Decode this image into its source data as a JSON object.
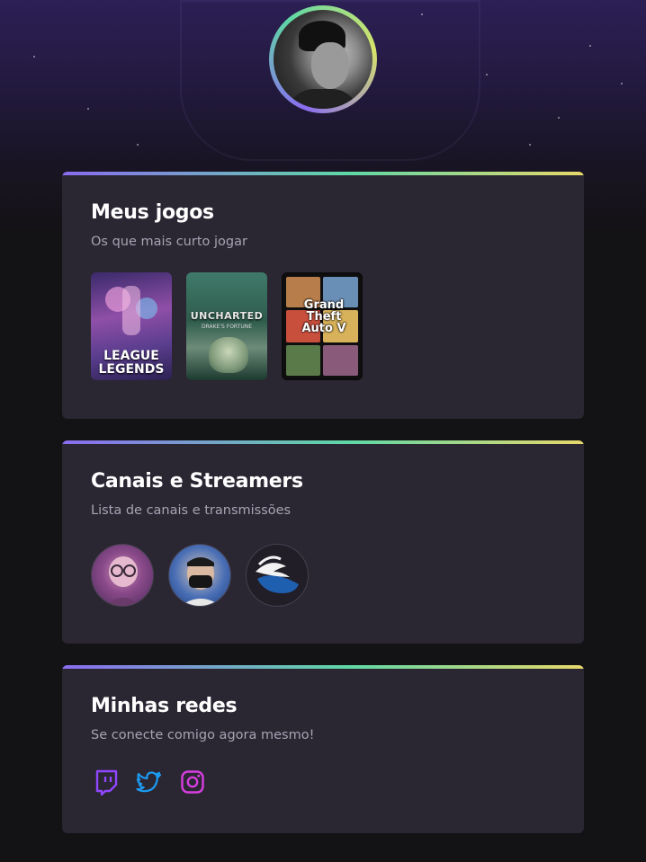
{
  "profile": {
    "avatar_alt": "profile-photo"
  },
  "colors": {
    "accent_purple": "#8a6cf0",
    "accent_green": "#5fd8a6",
    "accent_yellow": "#e8d86a",
    "card_bg": "#2a2632",
    "twitch": "#9146ff",
    "twitter": "#1d9bf0",
    "instagram": "#d63ee0"
  },
  "games_card": {
    "title": "Meus jogos",
    "subtitle": "Os que mais curto jogar",
    "games": [
      {
        "name": "League of Legends",
        "label_line1": "LEAGUE",
        "label_line2": "LEGENDS"
      },
      {
        "name": "Uncharted",
        "label_line1": "UNCHARTED",
        "label_line2": "DRAKE'S FORTUNE"
      },
      {
        "name": "Grand Theft Auto V",
        "label_line1": "Grand",
        "label_line2": "Theft",
        "label_line3": "Auto V"
      }
    ]
  },
  "streamers_card": {
    "title": "Canais e Streamers",
    "subtitle": "Lista de canais e transmissões",
    "streamers": [
      {
        "icon": "streamer-avatar-1"
      },
      {
        "icon": "streamer-avatar-2"
      },
      {
        "icon": "streamer-avatar-3"
      }
    ]
  },
  "social_card": {
    "title": "Minhas redes",
    "subtitle": "Se conecte comigo agora mesmo!",
    "networks": [
      {
        "icon": "twitch-icon"
      },
      {
        "icon": "twitter-icon"
      },
      {
        "icon": "instagram-icon"
      }
    ]
  }
}
